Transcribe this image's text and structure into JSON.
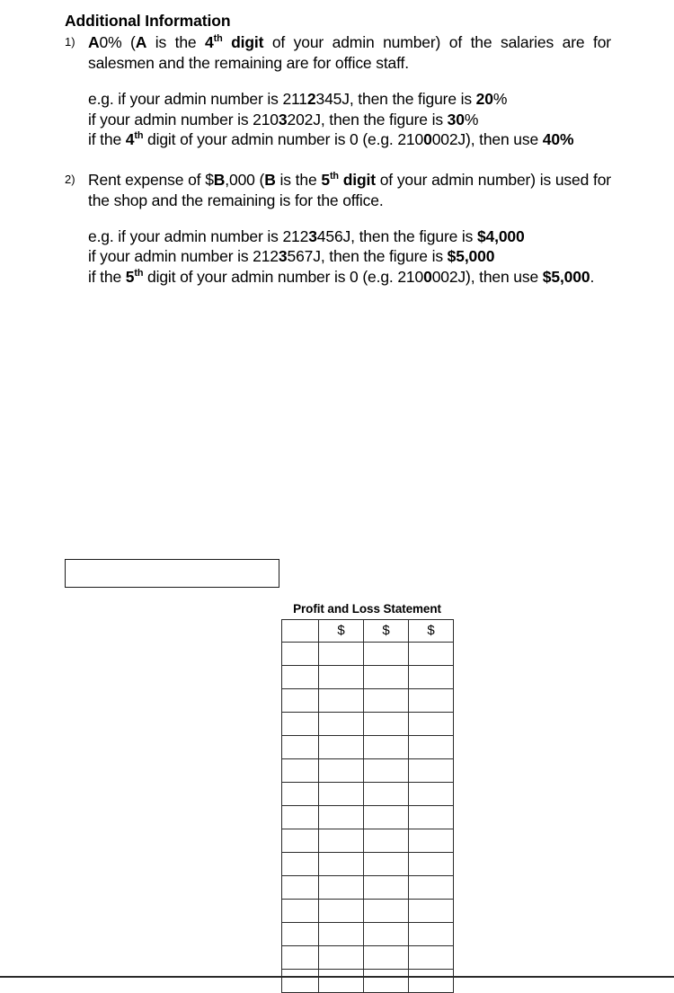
{
  "document": {
    "heading": "Additional Information",
    "items": [
      {
        "marker": "1)",
        "segments": [
          {
            "text": "A",
            "bold": true
          },
          {
            "text": "0% (",
            "bold": false
          },
          {
            "text": "A",
            "bold": true
          },
          {
            "text": " is the ",
            "bold": false
          },
          {
            "text": "4",
            "bold": true,
            "sup": "th"
          },
          {
            "text": " digit",
            "bold": true
          },
          {
            "text": " of your admin number) of the salaries are for salesmen and the remaining are for office staff.",
            "bold": false
          }
        ],
        "plain": "A0% (A is the 4th digit of your admin number) of the salaries are for salesmen and the remaining are for office staff."
      },
      {
        "marker": "2)",
        "segments": [
          {
            "text": "Rent expense of $",
            "bold": false
          },
          {
            "text": "B",
            "bold": true
          },
          {
            "text": ",000 (",
            "bold": false
          },
          {
            "text": "B",
            "bold": true
          },
          {
            "text": " is the ",
            "bold": false
          },
          {
            "text": "5",
            "bold": true,
            "sup": "th"
          },
          {
            "text": " digit",
            "bold": true
          },
          {
            "text": " of your admin number) is used for the shop and the remaining is for the office.",
            "bold": false
          }
        ],
        "plain": "Rent expense of $B,000 (B is the 5th digit of your admin number) is used for the shop and the remaining is for the office."
      }
    ],
    "example_1": {
      "line_1_prefix": "e.g. if your admin number is 211",
      "line_1_bold_digit": "2",
      "line_1_suffix": "345J, then the figure is ",
      "line_1_value": "20",
      "line_1_tail": "%",
      "line_2_prefix": "if your admin number is 210",
      "line_2_bold_digit": "3",
      "line_2_suffix": "202J, then the figure is ",
      "line_2_value": "30",
      "line_2_tail": "%",
      "line_3_prefix": "if the ",
      "line_3_ordinal": "4",
      "line_3_ordinal_sup": "th",
      "line_3_mid": " digit of your admin number is 0 (e.g. 210",
      "line_3_bold_digit": "0",
      "line_3_after": "002J), then use ",
      "line_3_value": "40%"
    },
    "example_2": {
      "line_1_prefix": "e.g. if your admin number is 212",
      "line_1_bold_digit": "3",
      "line_1_suffix": "456J, then the figure is ",
      "line_1_value": "$4,000",
      "line_1_tail": "",
      "line_2_prefix": "if your admin number is 212",
      "line_2_bold_digit": "3",
      "line_2_suffix": "567J, then the figure is ",
      "line_2_value": "$5,000",
      "line_2_tail": "",
      "line_3_prefix": "if the ",
      "line_3_ordinal": "5",
      "line_3_ordinal_sup": "th",
      "line_3_mid": " digit of your admin number is 0 (e.g. 210",
      "line_3_bold_digit": "0",
      "line_3_after": "002J), then use ",
      "line_3_value": "$5,000",
      "line_3_period": "."
    },
    "answer_box": {
      "value": "",
      "placeholder": ""
    },
    "profit_loss_table": {
      "title": "Profit and Loss Statement",
      "columns": [
        "",
        "$",
        "$",
        "$"
      ],
      "header_row": [
        "",
        "$",
        "$",
        "$"
      ],
      "body_row_count": 15,
      "body_rows": [
        [
          "",
          "",
          "",
          ""
        ],
        [
          "",
          "",
          "",
          ""
        ],
        [
          "",
          "",
          "",
          ""
        ],
        [
          "",
          "",
          "",
          ""
        ],
        [
          "",
          "",
          "",
          ""
        ],
        [
          "",
          "",
          "",
          ""
        ],
        [
          "",
          "",
          "",
          ""
        ],
        [
          "",
          "",
          "",
          ""
        ],
        [
          "",
          "",
          "",
          ""
        ],
        [
          "",
          "",
          "",
          ""
        ],
        [
          "",
          "",
          "",
          ""
        ],
        [
          "",
          "",
          "",
          ""
        ],
        [
          "",
          "",
          "",
          ""
        ],
        [
          "",
          "",
          "",
          ""
        ],
        [
          "",
          "",
          "",
          ""
        ]
      ]
    }
  },
  "colors": {
    "ink": "#000000",
    "rule": "#2b2b2b",
    "paper": "#ffffff"
  }
}
